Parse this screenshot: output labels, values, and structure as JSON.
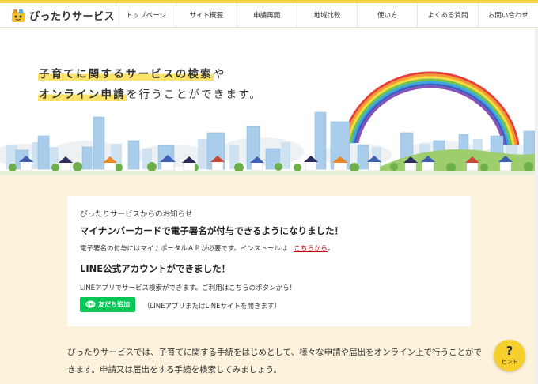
{
  "header": {
    "logo_text": "ぴったりサービス",
    "nav": [
      {
        "label": "トップページ"
      },
      {
        "label": "サイト概要"
      },
      {
        "label": "申請再開"
      },
      {
        "label": "地域比較"
      },
      {
        "label": "使い方"
      },
      {
        "label": "よくある質問"
      },
      {
        "label": "お問い合わせ"
      }
    ]
  },
  "hero": {
    "line1_highlight": "子育てに関するサービスの検索",
    "line1_rest": "や",
    "line2_highlight": "オンライン申請",
    "line2_rest": "を行うことができます。"
  },
  "notice": {
    "heading": "ぴったりサービスからのお知らせ",
    "news1_title": "マイナンバーカードで電子署名が付与できるようになりました！",
    "news1_body": "電子署名の付与にはマイナポータルＡＰが必要です。インストールは",
    "news1_link": "こちらから",
    "news1_end": "。",
    "news2_title": "LINE公式アカウントができました！",
    "news2_body": "LINEアプリでサービス検索ができます。ご利用はこちらのボタンから！",
    "line_button": "友だち追加",
    "line_note": "（LINEアプリまたはLINEサイトを開きます）"
  },
  "intro": {
    "text": "ぴったりサービスでは、子育てに関する手続をはじめとして、様々な申請や届出をオンライン上で行うことができます。申請又は届出をする手続を検索してみましょう。"
  },
  "hint": {
    "symbol": "?",
    "label": "ヒント"
  },
  "colors": {
    "accent": "#f2d23c",
    "highlight": "#fbe26a",
    "line_green": "#06c755",
    "link_red": "#c00000",
    "page_bg": "#fdf3dc"
  }
}
